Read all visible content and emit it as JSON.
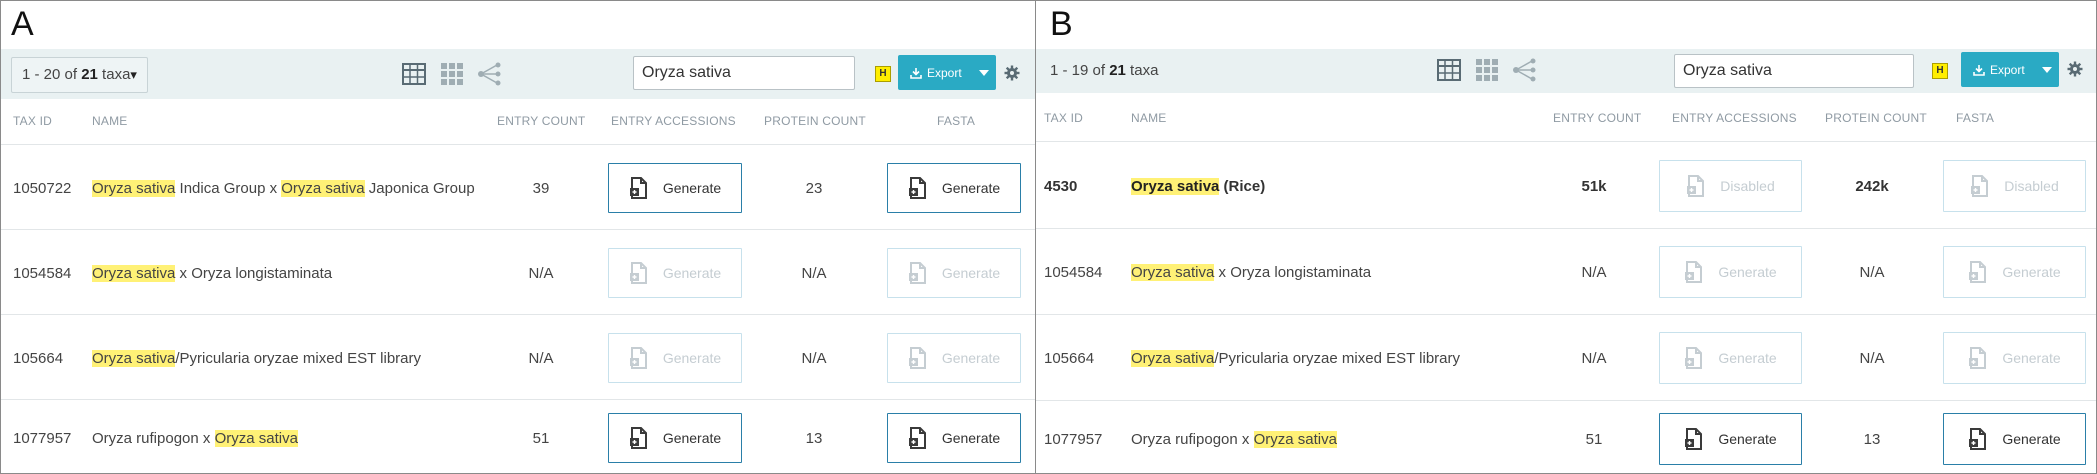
{
  "panels": {
    "a": {
      "letter": "A",
      "page_count": {
        "range": "1 - 20 of ",
        "total": "21",
        "unit": " taxa",
        "caret": "▾"
      },
      "search": {
        "value": "Oryza sativa"
      },
      "highlight_badge": "H",
      "export_label": "Export",
      "columns": [
        "TAX ID",
        "NAME",
        "ENTRY COUNT",
        "ENTRY ACCESSIONS",
        "PROTEIN COUNT",
        "FASTA"
      ],
      "rows": [
        {
          "tax_id": "1050722",
          "name_parts": [
            {
              "t": "Oryza sativa",
              "hl": true
            },
            {
              "t": " Indica Group x ",
              "hl": false
            },
            {
              "t": "Oryza sativa",
              "hl": true
            },
            {
              "t": " Japonica Group",
              "hl": false
            }
          ],
          "entry_count": "39",
          "entry_btn": "Generate",
          "entry_state": "enabled",
          "protein_count": "23",
          "fasta_btn": "Generate",
          "fasta_state": "enabled"
        },
        {
          "tax_id": "1054584",
          "name_parts": [
            {
              "t": "Oryza sativa",
              "hl": true
            },
            {
              "t": " x Oryza longistaminata",
              "hl": false
            }
          ],
          "entry_count": "N/A",
          "entry_btn": "Generate",
          "entry_state": "disabled",
          "protein_count": "N/A",
          "fasta_btn": "Generate",
          "fasta_state": "disabled"
        },
        {
          "tax_id": "105664",
          "name_parts": [
            {
              "t": "Oryza sativa",
              "hl": true
            },
            {
              "t": "/Pyricularia oryzae mixed EST library",
              "hl": false
            }
          ],
          "entry_count": "N/A",
          "entry_btn": "Generate",
          "entry_state": "disabled",
          "protein_count": "N/A",
          "fasta_btn": "Generate",
          "fasta_state": "disabled"
        },
        {
          "tax_id": "1077957",
          "name_parts": [
            {
              "t": "Oryza rufipogon x ",
              "hl": false
            },
            {
              "t": "Oryza sativa",
              "hl": true
            }
          ],
          "entry_count": "51",
          "entry_btn": "Generate",
          "entry_state": "enabled",
          "protein_count": "13",
          "fasta_btn": "Generate",
          "fasta_state": "enabled"
        }
      ]
    },
    "b": {
      "letter": "B",
      "page_count": {
        "range": "1 - 19 of ",
        "total": "21",
        "unit": " taxa",
        "caret": ""
      },
      "search": {
        "value": "Oryza sativa"
      },
      "highlight_badge": "H",
      "export_label": "Export",
      "columns": [
        "TAX ID",
        "NAME",
        "ENTRY COUNT",
        "ENTRY ACCESSIONS",
        "PROTEIN COUNT",
        "FASTA"
      ],
      "rows": [
        {
          "tax_id": "4530",
          "bold": true,
          "name_parts": [
            {
              "t": "Oryza sativa",
              "hl": true,
              "strong": true
            },
            {
              "t": " (Rice)",
              "hl": false
            }
          ],
          "entry_count": "51k",
          "entry_btn": "Disabled",
          "entry_state": "disabled",
          "protein_count": "242k",
          "fasta_btn": "Disabled",
          "fasta_state": "disabled"
        },
        {
          "tax_id": "1054584",
          "name_parts": [
            {
              "t": "Oryza sativa",
              "hl": true
            },
            {
              "t": " x Oryza longistaminata",
              "hl": false
            }
          ],
          "entry_count": "N/A",
          "entry_btn": "Generate",
          "entry_state": "disabled",
          "protein_count": "N/A",
          "fasta_btn": "Generate",
          "fasta_state": "disabled"
        },
        {
          "tax_id": "105664",
          "name_parts": [
            {
              "t": "Oryza sativa",
              "hl": true
            },
            {
              "t": "/Pyricularia oryzae mixed EST library",
              "hl": false
            }
          ],
          "entry_count": "N/A",
          "entry_btn": "Generate",
          "entry_state": "disabled",
          "protein_count": "N/A",
          "fasta_btn": "Generate",
          "fasta_state": "disabled"
        },
        {
          "tax_id": "1077957",
          "name_parts": [
            {
              "t": "Oryza rufipogon x ",
              "hl": false
            },
            {
              "t": "Oryza sativa",
              "hl": true
            }
          ],
          "entry_count": "51",
          "entry_btn": "Generate",
          "entry_state": "enabled",
          "protein_count": "13",
          "fasta_btn": "Generate",
          "fasta_state": "enabled"
        }
      ]
    }
  },
  "colors": {
    "accent": "#2aaac4",
    "toolbar_bg": "#e9f1f2",
    "highlight": "#fff176",
    "button_border": "#2a7fa8"
  },
  "icons": [
    "table-view-icon",
    "grid-view-icon",
    "tree-view-icon",
    "download-icon",
    "caret-down-icon",
    "gear-icon",
    "file-generate-icon"
  ]
}
